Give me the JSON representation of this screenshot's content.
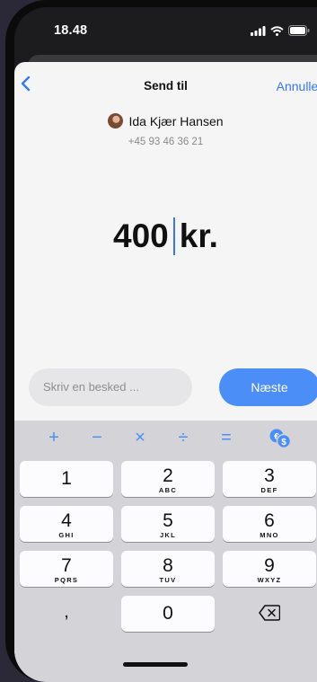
{
  "status": {
    "time": "18.48"
  },
  "nav": {
    "title": "Send til",
    "cancel_label": "Annuller"
  },
  "recipient": {
    "name": "Ida Kjær Hansen",
    "phone": "+45 93 46 36 21"
  },
  "amount": {
    "value": "400",
    "currency": "kr."
  },
  "message": {
    "placeholder": "Skriv en besked ..."
  },
  "next_label": "Næste",
  "operators": [
    "+",
    "−",
    "×",
    "÷",
    "="
  ],
  "keys": [
    {
      "num": "1",
      "sub": ""
    },
    {
      "num": "2",
      "sub": "ABC"
    },
    {
      "num": "3",
      "sub": "DEF"
    },
    {
      "num": "4",
      "sub": "GHI"
    },
    {
      "num": "5",
      "sub": "JKL"
    },
    {
      "num": "6",
      "sub": "MNO"
    },
    {
      "num": "7",
      "sub": "PQRS"
    },
    {
      "num": "8",
      "sub": "TUV"
    },
    {
      "num": "9",
      "sub": "WXYZ"
    },
    {
      "num": "0",
      "sub": ""
    }
  ],
  "decimal_key": ",",
  "colors": {
    "accent": "#3478f6",
    "button": "#4c8ef7",
    "keyboard_bg": "#d3d3d8",
    "sheet_bg": "#f5f5f5"
  },
  "icons": [
    "signal-icon",
    "wifi-icon",
    "battery-icon",
    "back-chevron-icon",
    "currency-convert-icon",
    "backspace-icon"
  ]
}
